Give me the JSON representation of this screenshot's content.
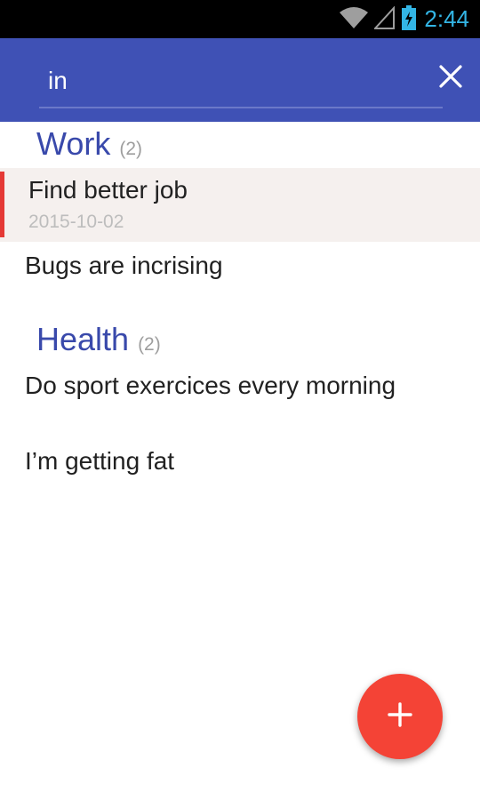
{
  "status_bar": {
    "time": "2:44",
    "icons": [
      "wifi-icon",
      "signal-icon",
      "battery-charging-icon"
    ],
    "accent_color": "#33b5e5"
  },
  "search": {
    "value": "in",
    "clear_icon": "close-icon",
    "bar_color": "#3f51b5"
  },
  "sections": [
    {
      "title": "Work",
      "count": "(2)",
      "notes": [
        {
          "title": "Find better job",
          "date": "2015-10-02",
          "selected": true
        },
        {
          "title": "Bugs are incrising"
        }
      ]
    },
    {
      "title": "Health",
      "count": "(2)",
      "notes": [
        {
          "title": "Do sport exercices every morning"
        },
        {
          "title": "I’m getting fat"
        }
      ]
    }
  ],
  "fab": {
    "icon": "plus-icon",
    "color": "#f44336"
  },
  "colors": {
    "section_title": "#3949ab",
    "selection_marker": "#e53935"
  }
}
